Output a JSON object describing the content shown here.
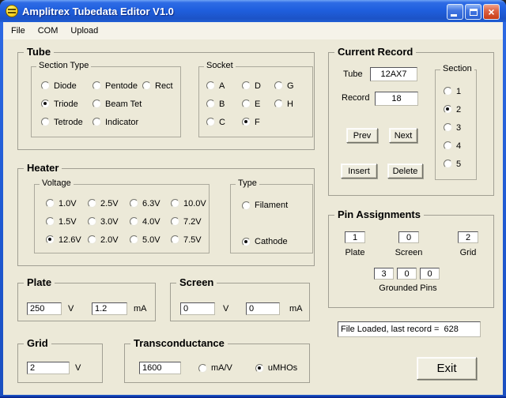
{
  "window": {
    "title": "Amplitrex Tubedata Editor V1.0",
    "close_glyph": "×"
  },
  "menu": {
    "items": [
      "File",
      "COM",
      "Upload"
    ]
  },
  "tube": {
    "caption": "Tube",
    "section_type": {
      "caption": "Section Type",
      "rows": [
        [
          "Diode",
          "Pentode",
          "Rect"
        ],
        [
          "Triode",
          "Beam Tet"
        ],
        [
          "Tetrode",
          "Indicator"
        ]
      ],
      "selected": "Triode"
    },
    "socket": {
      "caption": "Socket",
      "rows": [
        [
          "A",
          "D",
          "G"
        ],
        [
          "B",
          "E",
          "H"
        ],
        [
          "C",
          "F"
        ]
      ],
      "selected": "F"
    }
  },
  "heater": {
    "caption": "Heater",
    "voltage": {
      "caption": "Voltage",
      "rows": [
        [
          "1.0V",
          "2.5V",
          "6.3V",
          "10.0V"
        ],
        [
          "1.5V",
          "3.0V",
          "4.0V",
          "7.2V"
        ],
        [
          "12.6V",
          "2.0V",
          "5.0V",
          "7.5V"
        ]
      ],
      "selected": "12.6V"
    },
    "type": {
      "caption": "Type",
      "rows": [
        [
          "Filament"
        ],
        [
          "Cathode"
        ]
      ],
      "selected": "Cathode"
    }
  },
  "current_record": {
    "caption": "Current Record",
    "tube_label": "Tube",
    "tube_value": "12AX7",
    "record_label": "Record",
    "record_value": "18",
    "buttons": {
      "prev": "Prev",
      "next": "Next",
      "insert": "Insert",
      "delete": "Delete"
    },
    "section": {
      "caption": "Section",
      "rows": [
        [
          "1"
        ],
        [
          "2"
        ],
        [
          "3"
        ],
        [
          "4"
        ],
        [
          "5"
        ]
      ],
      "selected": "2"
    }
  },
  "pin_assignments": {
    "caption": "Pin Assignments",
    "pins": [
      {
        "label": "Plate",
        "value": "1"
      },
      {
        "label": "Screen",
        "value": "0"
      },
      {
        "label": "Grid",
        "value": "2"
      }
    ],
    "grounded": {
      "label": "Grounded Pins",
      "values": [
        "3",
        "0",
        "0"
      ]
    }
  },
  "plate": {
    "caption": "Plate",
    "voltage": "250",
    "voltage_unit": "V",
    "current": "1.2",
    "current_unit": "mA"
  },
  "screen": {
    "caption": "Screen",
    "voltage": "0",
    "voltage_unit": "V",
    "current": "0",
    "current_unit": "mA"
  },
  "grid": {
    "caption": "Grid",
    "voltage": "2",
    "voltage_unit": "V"
  },
  "transconductance": {
    "caption": "Transconductance",
    "value": "1600",
    "units": {
      "rows": [
        [
          "mA/V",
          "uMHOs"
        ]
      ],
      "selected": "uMHOs"
    }
  },
  "status": {
    "text": "File Loaded, last record =  628"
  },
  "exit_button": {
    "label": "Exit"
  },
  "colors": {
    "titlebar_blue": "#1E5AD6",
    "window_face": "#ECE9D8",
    "close_red": "#D44A22"
  }
}
